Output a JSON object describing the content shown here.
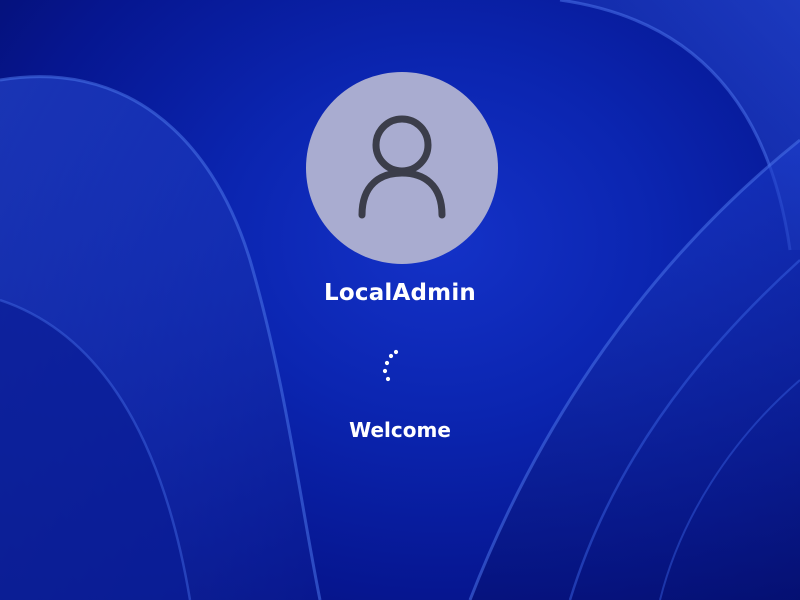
{
  "lock_screen": {
    "username": "LocalAdmin",
    "status_text": "Welcome"
  },
  "icons": {
    "avatar": "user-icon",
    "spinner": "loading-spinner-icon"
  },
  "colors": {
    "background": "#0b25b0",
    "avatar_bg": "#a9acd0",
    "avatar_glyph": "#3b3d4a",
    "text": "#ffffff"
  }
}
